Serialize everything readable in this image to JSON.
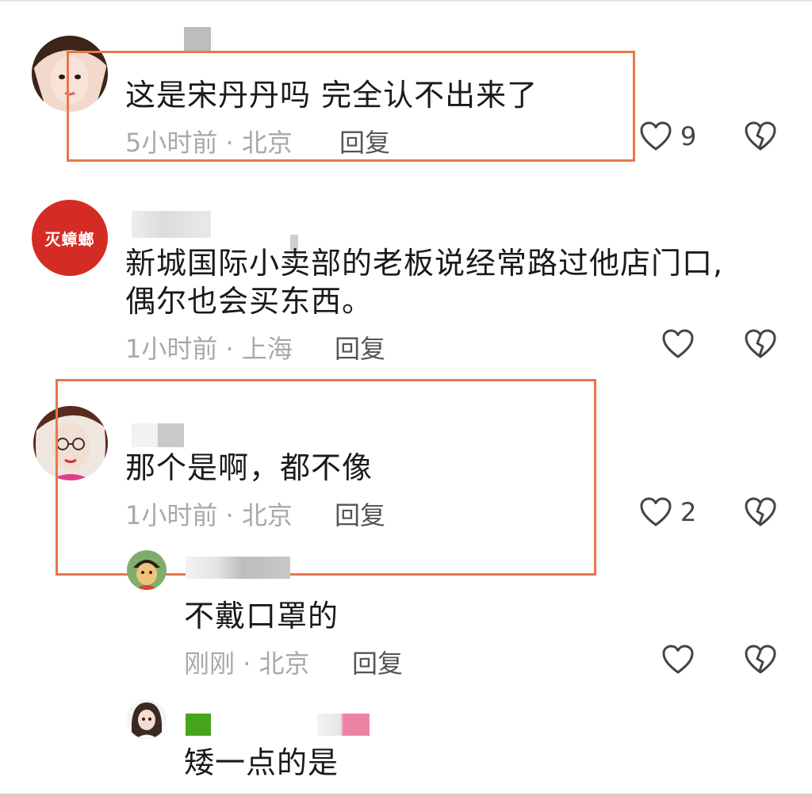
{
  "comments": [
    {
      "text": "这是宋丹丹吗 完全认不出来了",
      "time": "5小时前",
      "location": "北京",
      "reply": "回复",
      "likes": "9"
    },
    {
      "avatar_text": "灭蟑螂",
      "text": "新城国际小卖部的老板说经常路过他店门口,",
      "text2": "偶尔也会买东西。",
      "time": "1小时前",
      "location": "上海",
      "reply": "回复",
      "likes": ""
    },
    {
      "text": "那个是啊，都不像",
      "time": "1小时前",
      "location": "北京",
      "reply": "回复",
      "likes": "2"
    },
    {
      "text": "不戴口罩的",
      "time": "刚刚",
      "location": "北京",
      "reply": "回复",
      "likes": ""
    },
    {
      "text": "矮一点的是"
    }
  ],
  "meta_separator": "·",
  "colors": {
    "highlight_border": "#e8774b",
    "avatar2_bg": "#d42b24",
    "meta_text": "#a9a9a9"
  },
  "icons": [
    "heart-outline-icon",
    "broken-heart-icon"
  ]
}
